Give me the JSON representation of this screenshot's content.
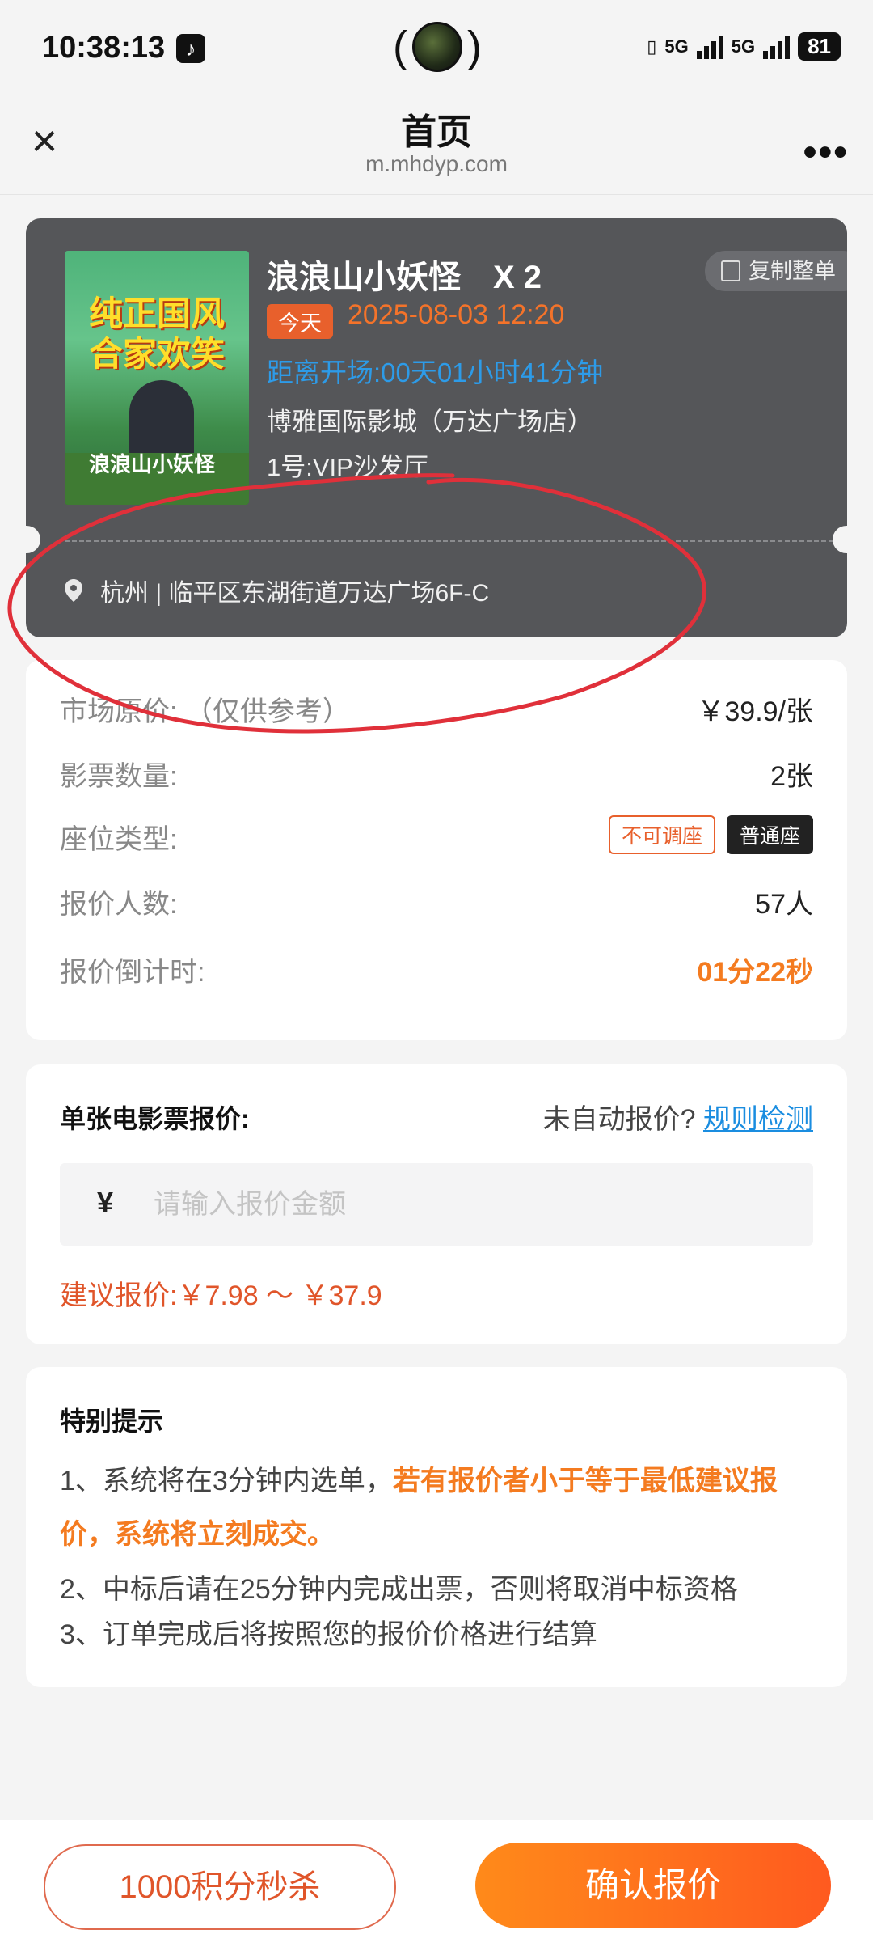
{
  "status_bar": {
    "time": "10:38:13",
    "net1": "5G",
    "net2": "5G",
    "battery": "81"
  },
  "nav": {
    "title": "首页",
    "url": "m.mhdyp.com"
  },
  "ticket": {
    "poster_text_line1": "纯正国风",
    "poster_text_line2": "合家欢笑",
    "poster_title": "浪浪山小妖怪",
    "movie_title": "浪浪山小妖怪　X 2",
    "copy_label": "复制整单",
    "today_badge": "今天",
    "datetime": "2025-08-03 12:20",
    "countdown": "距离开场:00天01小时41分钟",
    "cinema": "博雅国际影城（万达广场店）",
    "hall": "1号:VIP沙发厅",
    "address": "杭州 | 临平区东湖街道万达广场6F-C"
  },
  "info": {
    "market_price_label": "市场原价: （仅供参考）",
    "market_price_value": "￥39.9/张",
    "ticket_count_label": "影票数量:",
    "ticket_count_value": "2张",
    "seat_type_label": "座位类型:",
    "seat_tag1": "不可调座",
    "seat_tag2": "普通座",
    "bidders_label": "报价人数:",
    "bidders_value": "57人",
    "bid_countdown_label": "报价倒计时:",
    "bid_countdown_value": "01分22秒"
  },
  "quote": {
    "title": "单张电影票报价:",
    "auto_question": "未自动报价?",
    "rule_link": "规则检测",
    "currency": "¥",
    "placeholder": "请输入报价金额",
    "suggest": "建议报价:￥7.98 ～ ￥37.9"
  },
  "tips": {
    "title": "特别提示",
    "line1_normal": "1、系统将在3分钟内选单，",
    "line1_highlight": "若有报价者小于等于最低建议报价，系统将立刻成交。",
    "line2": "2、中标后请在25分钟内完成出票，否则将取消中标资格",
    "line3": "3、订单完成后将按照您的报价价格进行结算"
  },
  "bottom": {
    "secondary_button": "1000积分秒杀",
    "primary_button": "确认报价"
  },
  "colors": {
    "accent_orange": "#f47b20",
    "link_blue": "#1a8de0",
    "annotation_red": "#e0303a"
  }
}
